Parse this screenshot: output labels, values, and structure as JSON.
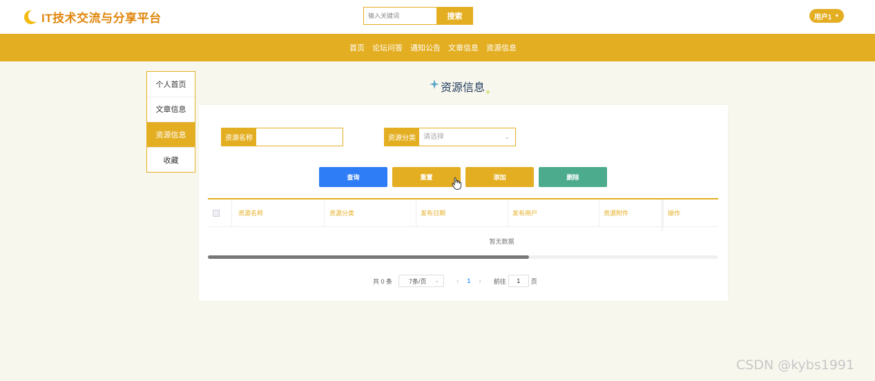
{
  "header": {
    "logo_text": "IT技术交流与分享平台",
    "search_placeholder": "输入关键词",
    "search_button": "搜索",
    "user_label": "用户1"
  },
  "nav": {
    "items": [
      {
        "label": "首页"
      },
      {
        "label": "论坛问答"
      },
      {
        "label": "通知公告"
      },
      {
        "label": "文章信息"
      },
      {
        "label": "资源信息"
      }
    ]
  },
  "sidebar": {
    "items": [
      {
        "label": "个人首页",
        "active": false
      },
      {
        "label": "文章信息",
        "active": false
      },
      {
        "label": "资源信息",
        "active": true
      },
      {
        "label": "收藏",
        "active": false
      }
    ]
  },
  "page": {
    "title": "资源信息"
  },
  "filters": {
    "name_label": "资源名称",
    "name_value": "",
    "category_label": "资源分类",
    "category_placeholder": "请选择"
  },
  "buttons": {
    "query": "查询",
    "reset": "重置",
    "add": "添加",
    "delete": "删除"
  },
  "table": {
    "columns": [
      "资源名称",
      "资源分类",
      "发布日期",
      "发布用户",
      "资源附件",
      "操作"
    ],
    "rows": [],
    "empty_text": "暂无数据"
  },
  "pagination": {
    "total_text": "共 0 条",
    "page_size": "7条/页",
    "current_page": "1",
    "goto_label": "前往",
    "goto_value": "1",
    "page_suffix": "页"
  },
  "watermark": "CSDN @kybs1991",
  "colors": {
    "accent": "#e4ae22",
    "query_button": "#2e7cf6",
    "delete_button": "#4caa8d",
    "logo_text": "#e0860c"
  }
}
